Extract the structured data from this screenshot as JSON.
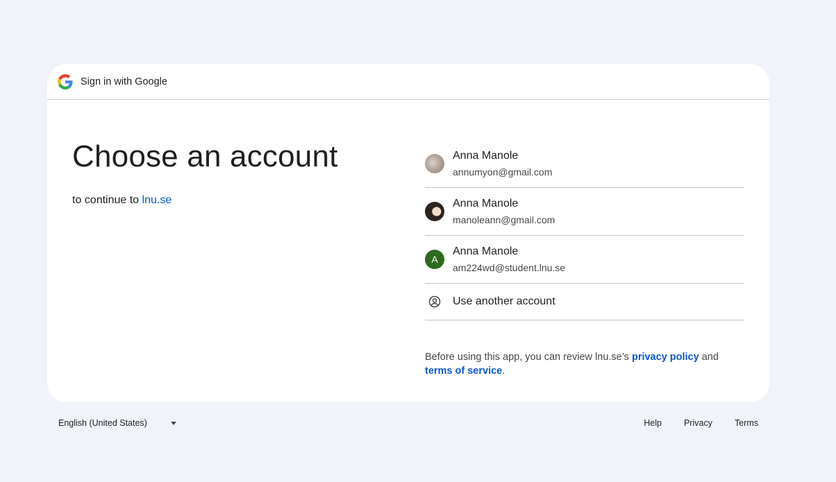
{
  "header": {
    "title": "Sign in with Google",
    "logo_icon": "google-g-icon"
  },
  "main": {
    "headline": "Choose an account",
    "subtitle_prefix": "to continue to",
    "subtitle_link": "lnu.se"
  },
  "accounts": [
    {
      "name": "Anna Manole",
      "email": "annumyon@gmail.com",
      "avatar": "photo"
    },
    {
      "name": "Anna Manole",
      "email": "manoleann@gmail.com",
      "avatar": "photo"
    },
    {
      "name": "Anna Manole",
      "email": "am224wd@student.lnu.se",
      "avatar_letter": "A",
      "avatar_color": "#2d6a1e"
    }
  ],
  "other_account": {
    "label": "Use another account",
    "icon": "account-circle-icon"
  },
  "notice": {
    "prefix": "Before using this app, you can review lnu.se’s",
    "privacy_link": "privacy policy",
    "and": "and",
    "terms_link": "terms of service",
    "suffix": "."
  },
  "footer": {
    "language": "English (United States)",
    "links": [
      "Help",
      "Privacy",
      "Terms"
    ]
  },
  "colors": {
    "link": "#0b57d0",
    "background": "#f0f4f9",
    "card": "#ffffff"
  }
}
